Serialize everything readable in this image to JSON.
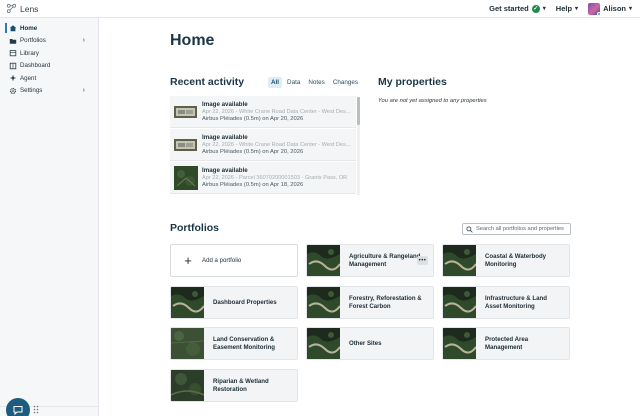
{
  "app": {
    "name": "Lens"
  },
  "header": {
    "get_started": "Get started",
    "help": "Help",
    "user_name": "Alison"
  },
  "sidebar": {
    "items": [
      {
        "label": "Home",
        "icon": "home-icon",
        "active": true
      },
      {
        "label": "Portfolios",
        "icon": "folder-icon",
        "has_children": true
      },
      {
        "label": "Library",
        "icon": "library-icon"
      },
      {
        "label": "Dashboard",
        "icon": "dashboard-icon"
      },
      {
        "label": "Agent",
        "icon": "sparkle-icon"
      },
      {
        "label": "Settings",
        "icon": "gear-icon",
        "has_children": true
      }
    ]
  },
  "page": {
    "title": "Home"
  },
  "recent_activity": {
    "title": "Recent activity",
    "filters": [
      "All",
      "Data",
      "Notes",
      "Changes"
    ],
    "active_filter": "All",
    "items": [
      {
        "title": "Image available",
        "meta": "Apr 22, 2026 - White Crane Road Data Center - West Des...",
        "source": "Airbus Pléiades (0.5m) on Apr 20, 2026"
      },
      {
        "title": "Image available",
        "meta": "Apr 22, 2026 - White Crane Road Data Center - West Des...",
        "source": "Airbus Pléiades (0.5m) on Apr 20, 2026"
      },
      {
        "title": "Image available",
        "meta": "Apr 22, 2026 - Parcel 36070200001503 - Grants Pass, OR",
        "source": "Airbus Pléiades (0.5m) on Apr 18, 2026"
      }
    ]
  },
  "my_properties": {
    "title": "My properties",
    "empty_text": "You are not yet assigned to any properties"
  },
  "portfolios": {
    "title": "Portfolios",
    "search_placeholder": "Search all portfolios and properties",
    "add_label": "Add a portfolio",
    "more_label": "•••",
    "cards": [
      {
        "label": "Agriculture & Rangeland Management"
      },
      {
        "label": "Coastal & Waterbody Monitoring"
      },
      {
        "label": "Dashboard Properties"
      },
      {
        "label": "Forestry, Reforestation & Forest Carbon"
      },
      {
        "label": "Infrastructure & Land Asset Monitoring"
      },
      {
        "label": "Land Conservation & Easement Monitoring"
      },
      {
        "label": "Other Sites"
      },
      {
        "label": "Protected Area Management"
      },
      {
        "label": "Riparian & Wetland Restoration"
      }
    ]
  },
  "colors": {
    "accent": "#2d7fa8",
    "success": "#1f8a4c",
    "chat_button": "#1d5c7e"
  }
}
